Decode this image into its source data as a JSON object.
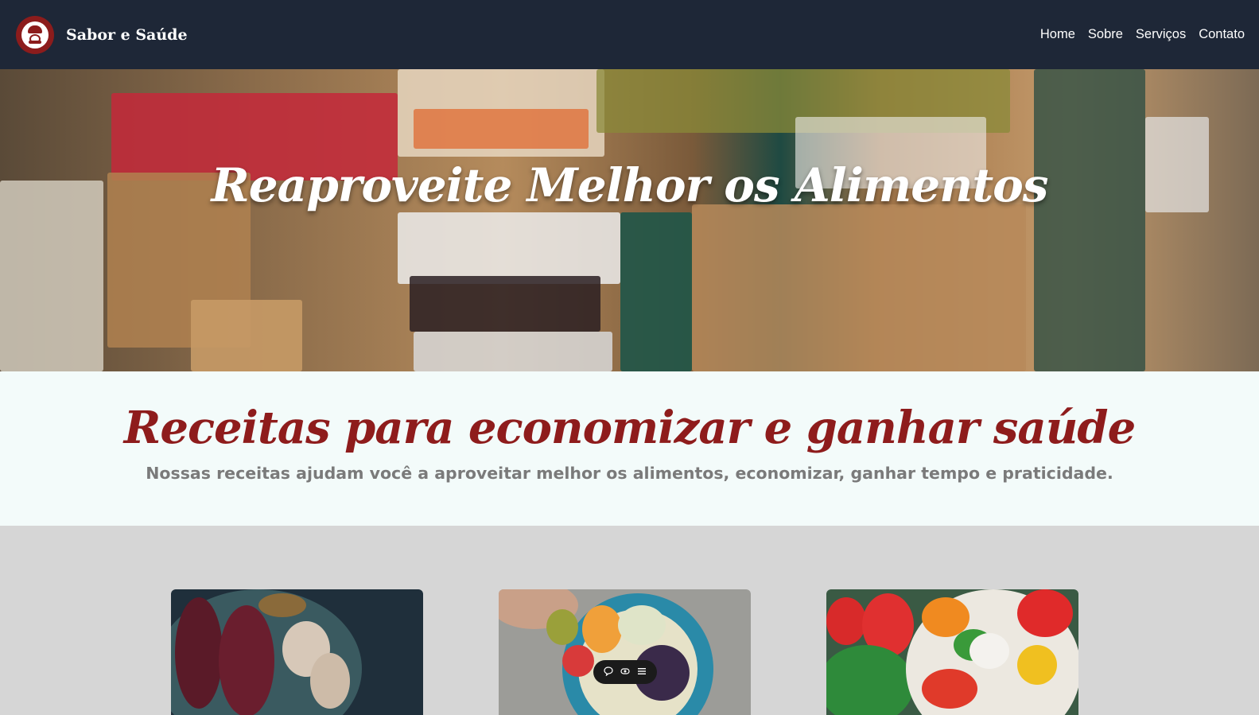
{
  "header": {
    "brand_name": "Sabor e Saúde",
    "logo_icon": "chef-logo-icon",
    "nav": [
      "Home",
      "Sobre",
      "Serviços",
      "Contato"
    ]
  },
  "hero": {
    "title": "Reaproveite Melhor os Alimentos"
  },
  "intro": {
    "title": "Receitas para economizar e ganhar saúde",
    "subtitle": "Nossas receitas ajudam você a aproveitar melhor os alimentos, economizar, ganhar tempo e praticidade."
  },
  "cards": [
    {
      "image": "beets-garlic-bowl-image"
    },
    {
      "image": "salad-plate-olive-oil-image"
    },
    {
      "image": "tomato-pepper-salad-image"
    }
  ],
  "floating_toolbar": {
    "icons": [
      "comment-icon",
      "eye-icon",
      "menu-icon"
    ]
  },
  "colors": {
    "navbar_bg": "#1e2737",
    "accent_red": "#8e1c1c",
    "intro_bg": "#f3fbfa",
    "page_bg": "#d6d6d6"
  }
}
